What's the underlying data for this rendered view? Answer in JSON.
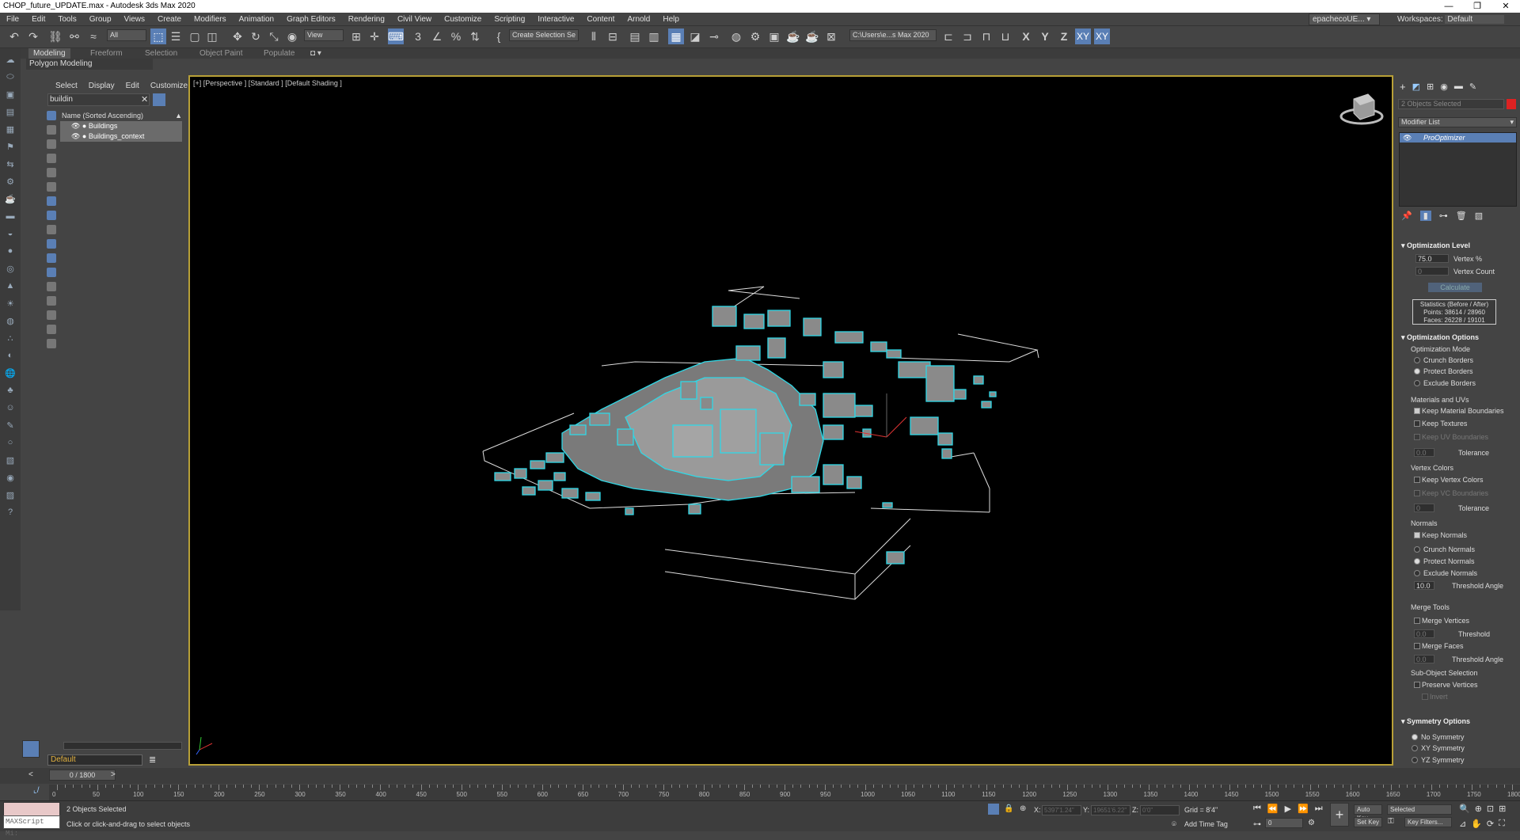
{
  "window": {
    "title": "CHOP_future_UPDATE.max - Autodesk 3ds Max 2020",
    "controls": [
      "—",
      "❐",
      "✕"
    ]
  },
  "menu": [
    "File",
    "Edit",
    "Tools",
    "Group",
    "Views",
    "Create",
    "Modifiers",
    "Animation",
    "Graph Editors",
    "Rendering",
    "Civil View",
    "Customize",
    "Scripting",
    "Interactive",
    "Content",
    "Arnold",
    "Help"
  ],
  "user": {
    "name": "epachecoUE... ▾",
    "workspace_label": "Workspaces:",
    "workspace": "Default"
  },
  "toolbar": {
    "selection_filter": "All",
    "ref_coord": "View",
    "named_sets": "Create Selection Se",
    "project_path": "C:\\Users\\e...s Max 2020",
    "axis_x": "X",
    "axis_y": "Y",
    "axis_z": "Z",
    "axis_xy": "XY",
    "axis_xy2": "XY"
  },
  "ribbon": {
    "tabs": [
      "Modeling",
      "Freeform",
      "Selection",
      "Object Paint",
      "Populate"
    ],
    "sub": "Polygon Modeling"
  },
  "scene_explorer": {
    "tabs": [
      "Select",
      "Display",
      "Edit",
      "Customize"
    ],
    "search": "buildin",
    "column_header": "Name (Sorted Ascending)",
    "items": [
      {
        "name": "Buildings"
      },
      {
        "name": "Buildings_context"
      }
    ],
    "layer": "Default"
  },
  "viewport": {
    "label": "[+] [Perspective ] [Standard ] [Default Shading ]"
  },
  "command_panel": {
    "selection": "2 Objects Selected",
    "modifier_list": "Modifier List",
    "modifier": "ProOptimizer",
    "optimization_level": {
      "title": "Optimization Level",
      "vertex_pct": "75.0",
      "vertex_pct_label": "Vertex %",
      "vertex_count": "0",
      "vertex_count_label": "Vertex Count",
      "calculate": "Calculate"
    },
    "statistics": {
      "title": "Statistics (Before / After)",
      "points": "Points: 38614 / 28960",
      "faces": "Faces: 26228 / 19101"
    },
    "optimization_options": {
      "title": "Optimization Options",
      "mode_label": "Optimization Mode",
      "modes": [
        "Crunch Borders",
        "Protect Borders",
        "Exclude Borders"
      ],
      "mat_label": "Materials and UVs",
      "keep_material": "Keep Material Boundaries",
      "keep_textures": "Keep Textures",
      "keep_uv": "Keep UV Boundaries",
      "tol1": "0.0",
      "tolerance": "Tolerance",
      "vc_label": "Vertex Colors",
      "keep_vc": "Keep Vertex Colors",
      "keep_vcb": "Keep VC Boundaries",
      "tol2": "0",
      "normals_label": "Normals",
      "keep_normals": "Keep Normals",
      "normal_modes": [
        "Crunch Normals",
        "Protect Normals",
        "Exclude Normals"
      ],
      "threshold_val": "10.0",
      "threshold_angle": "Threshold Angle",
      "merge_label": "Merge Tools",
      "merge_vertices": "Merge Vertices",
      "mv_val": "0.0",
      "threshold": "Threshold",
      "merge_faces": "Merge Faces",
      "mf_val": "0.0",
      "threshold_angle2": "Threshold Angle",
      "subobj_label": "Sub-Object Selection",
      "preserve_vertices": "Preserve Vertices",
      "invert": "Invert"
    },
    "symmetry": {
      "title": "Symmetry Options",
      "options": [
        "No Symmetry",
        "XY Symmetry",
        "YZ Symmetry"
      ]
    }
  },
  "timeline": {
    "slider": "0 / 1800",
    "ticks": [
      "0",
      "50",
      "100",
      "150",
      "200",
      "250",
      "300",
      "350",
      "400",
      "450",
      "500",
      "550",
      "600",
      "650",
      "700",
      "750",
      "800",
      "850",
      "900",
      "950",
      "1000",
      "1050",
      "1100",
      "1150",
      "1200",
      "1250",
      "1300",
      "1350",
      "1400",
      "1450",
      "1500",
      "1550",
      "1600",
      "1650",
      "1700",
      "1750",
      "1800"
    ]
  },
  "status": {
    "maxscript": "MAXScript Mi:",
    "selected": "2 Objects Selected",
    "prompt": "Click or click-and-drag to select objects",
    "x_label": "X:",
    "x_val": "5397'1.24\"",
    "y_label": "Y:",
    "y_val": "19651'6.22\"",
    "z_label": "Z:",
    "z_val": "0'0\"",
    "grid": "Grid = 8'4\"",
    "add_time_tag": "Add Time Tag",
    "auto_key": "Auto Key",
    "key_mode": "Selected",
    "set_key": "Set Key",
    "key_filters": "Key Filters...",
    "frame": "0"
  }
}
